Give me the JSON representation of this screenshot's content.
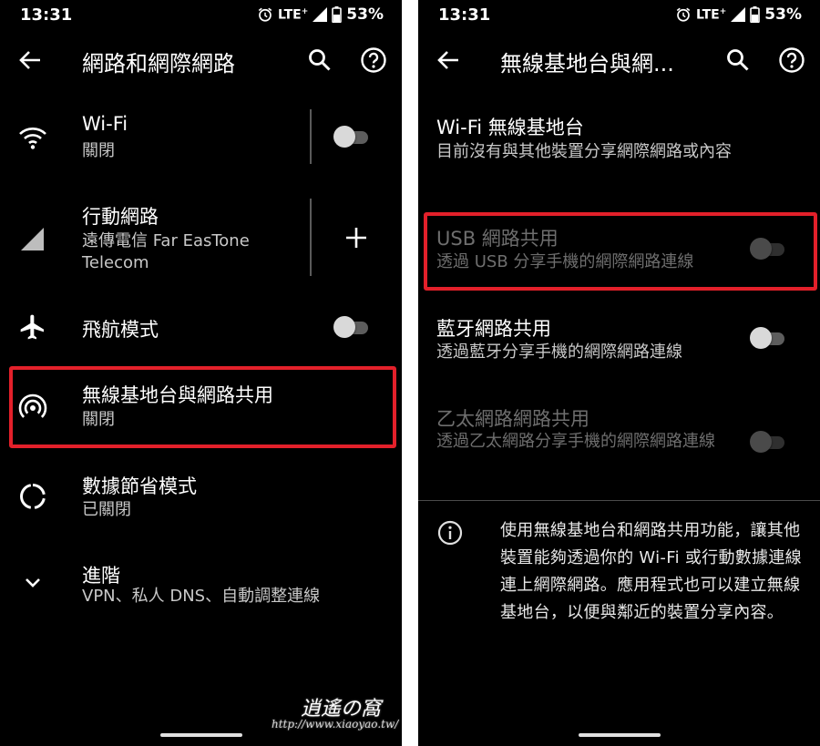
{
  "status": {
    "time": "13:31",
    "network": "LTE",
    "network_sup": "+",
    "battery": "53%"
  },
  "left": {
    "toolbar_title": "網路和網際網路",
    "items": [
      {
        "title": "Wi-Fi",
        "sub": "關閉"
      },
      {
        "title": "行動網路",
        "sub": "遠傳電信 Far EasTone Telecom"
      },
      {
        "title": "飛航模式"
      },
      {
        "title": "無線基地台與網路共用",
        "sub": "關閉"
      },
      {
        "title": "數據節省模式",
        "sub": "已關閉"
      },
      {
        "title": "進階",
        "sub": "VPN、私人 DNS、自動調整連線"
      }
    ]
  },
  "right": {
    "toolbar_title": "無線基地台與網...",
    "items": [
      {
        "title": "Wi-Fi 無線基地台",
        "sub": "目前沒有與其他裝置分享網際網路或內容"
      },
      {
        "title": "USB 網路共用",
        "sub": "透過 USB 分享手機的網際網路連線"
      },
      {
        "title": "藍牙網路共用",
        "sub": "透過藍牙分享手機的網際網路連線"
      },
      {
        "title": "乙太網路網路共用",
        "sub": "透過乙太網路分享手機的網際網路連線"
      }
    ],
    "info": "使用無線基地台和網路共用功能，讓其他裝置能夠透過你的 Wi-Fi 或行動數據連線連上網際網路。應用程式也可以建立無線基地台，以便與鄰近的裝置分享內容。"
  },
  "watermark": {
    "name": "逍遙の窩",
    "url": "http://www.xiaoyao.tw/"
  },
  "colors": {
    "background": "#000000",
    "highlight": "#e3202a",
    "text_secondary": "#c8c8c8",
    "text_disabled": "#6e6e6e"
  },
  "icons": [
    "wifi-icon",
    "signal-icon",
    "airplane-icon",
    "hotspot-icon",
    "data-saver-icon",
    "chevron-down-icon",
    "search-icon",
    "help-icon",
    "back-arrow-icon",
    "add-icon",
    "info-icon",
    "alarm-icon",
    "battery-icon"
  ]
}
